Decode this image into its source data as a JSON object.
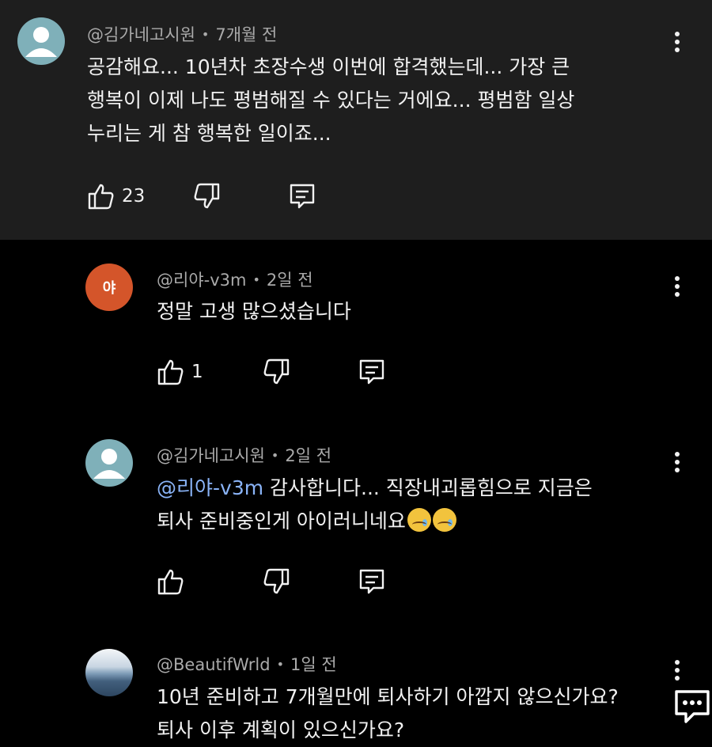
{
  "comments": [
    {
      "author": "@김가네고시원",
      "time": "7개월 전",
      "lines": [
        "공감해요... 10년차 초장수생 이번에 합격했는데... 가장 큰",
        "행복이 이제 나도 평범해질 수 있다는 거에요... 평범함 일상",
        "누리는 게 참 행복한 일이죠..."
      ],
      "likes": "23"
    },
    {
      "author": "@리야-v3m",
      "avatar_letter": "야",
      "time": "2일 전",
      "lines": [
        "정말 고생 많으셨습니다"
      ],
      "likes": "1"
    },
    {
      "author": "@김가네고시원",
      "time": "2일 전",
      "mention": "@리야-v3m",
      "lines": [
        " 감사합니다... 직장내괴롭힘으로 지금은",
        "퇴사 준비중인게 아이러니네요"
      ],
      "likes": ""
    },
    {
      "author": "@BeautifWrld",
      "time": "1일 전",
      "lines": [
        "10년 준비하고 7개월만에 퇴사하기 아깝지 않으신가요?",
        "퇴사 이후 계획이 있으신가요?"
      ]
    }
  ],
  "separator": "•",
  "colors": {
    "top_bg": "#1e1e1e",
    "page_bg": "#000000",
    "meta": "#aaaaaa",
    "text": "#f1f1f1",
    "mention": "#8ab4f8",
    "letter_avatar": "#d4552a"
  },
  "icons": {
    "like": "thumbs-up-icon",
    "dislike": "thumbs-down-icon",
    "reply": "reply-icon",
    "more": "more-vert-icon",
    "fab": "comment-bubble-icon"
  }
}
